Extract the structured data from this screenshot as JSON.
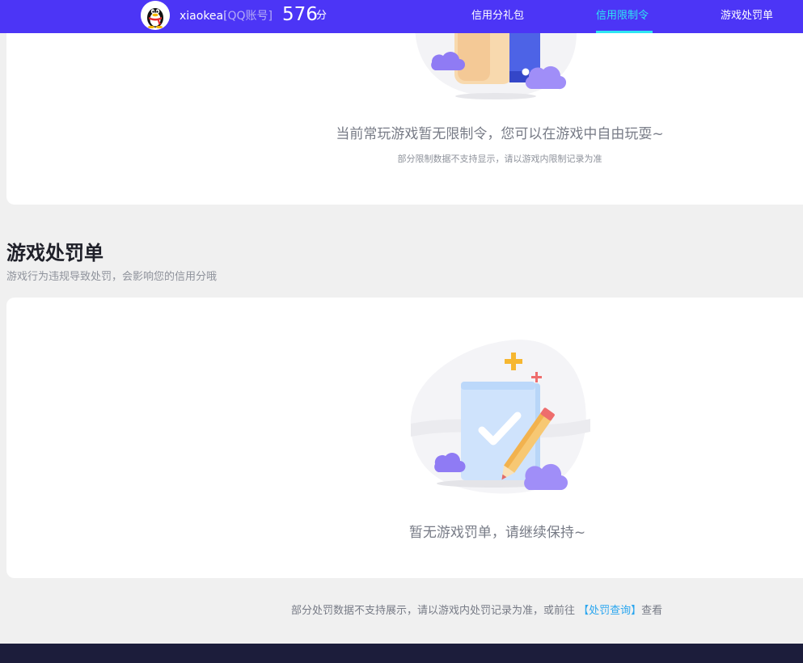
{
  "header": {
    "user_name": "xiaokeai",
    "account_type": "[QQ账号]",
    "score": "576",
    "score_unit": "分",
    "nav": [
      {
        "label": "信用分礼包",
        "active": false
      },
      {
        "label": "信用限制令",
        "active": true
      },
      {
        "label": "游戏处罚单",
        "active": false
      }
    ],
    "active_color": "#2ee6f2",
    "bar_color": "#4c35f6"
  },
  "restriction": {
    "empty_message": "当前常玩游戏暂无限制令，您可以在游戏中自由玩耍~",
    "note": "部分限制数据不支持显示，请以游戏内限制记录为准"
  },
  "penalty": {
    "title": "游戏处罚单",
    "description": "游戏行为违规导致处罚，会影响您的信用分哦",
    "empty_message": "暂无游戏罚单，请继续保持~",
    "footnote_prefix": "部分处罚数据不支持展示，请以游戏内处罚记录为准，或前往",
    "footnote_link": "【处罚查询】",
    "footnote_suffix": "查看"
  },
  "icons": {
    "avatar": "qq-penguin-avatar-icon",
    "restriction_illustration": "thumbs-up-illustration-icon",
    "penalty_illustration": "checked-document-pencil-illustration-icon"
  }
}
